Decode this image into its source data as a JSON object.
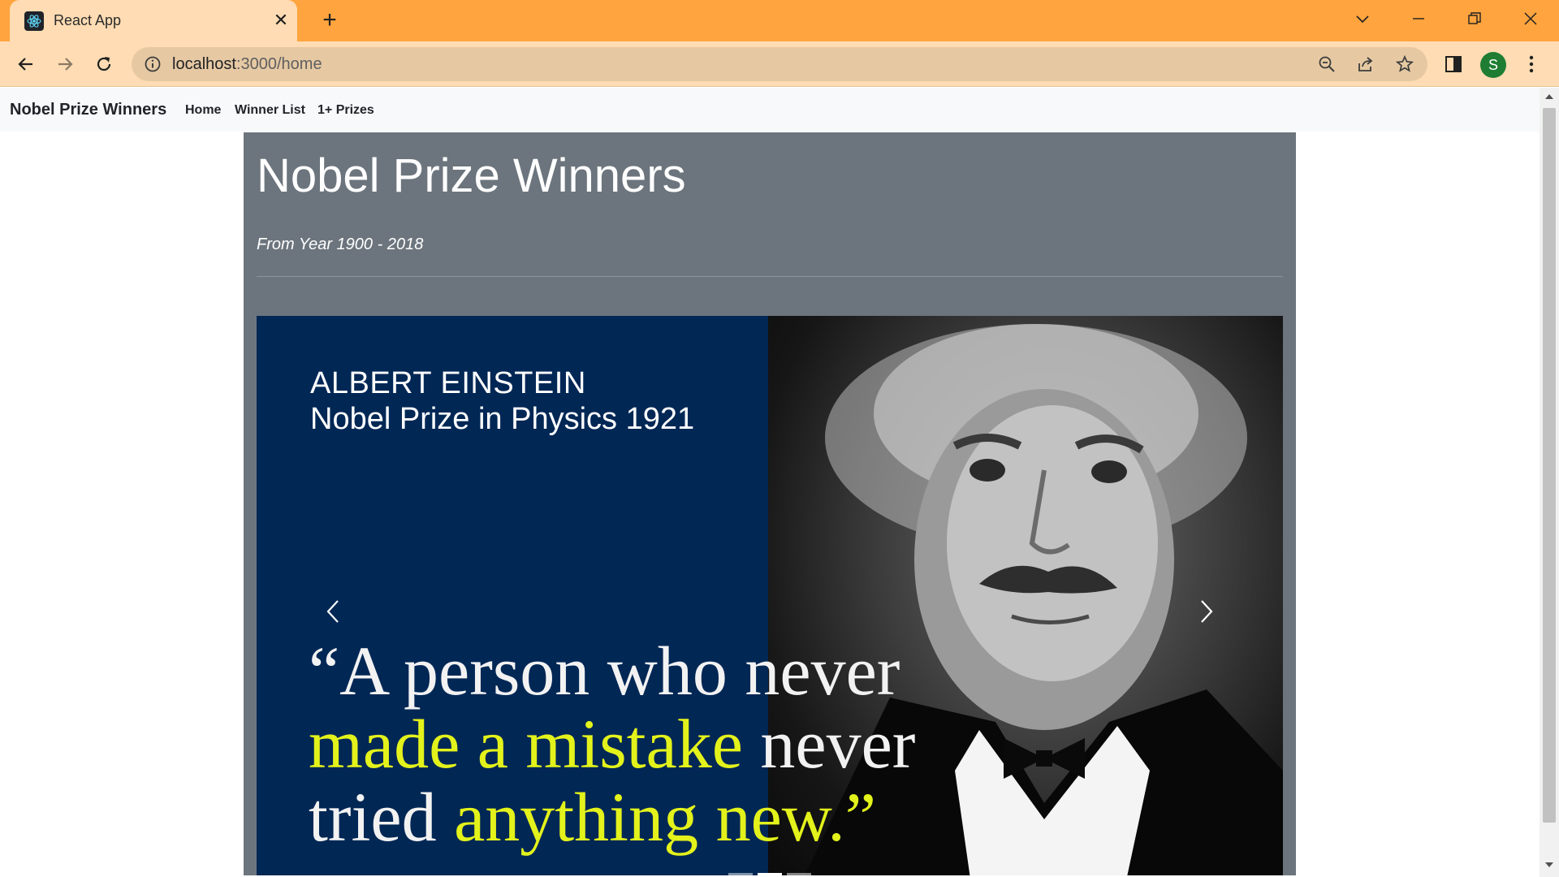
{
  "browser": {
    "tab_title": "React App",
    "tab_close": "✕",
    "new_tab": "+",
    "avatar_letter": "S",
    "url_host": "localhost",
    "url_rest": ":3000/home",
    "icons": [
      "react-favicon",
      "chevron-down-icon",
      "minimize-icon",
      "restore-icon",
      "close-icon",
      "back-arrow-icon",
      "forward-arrow-icon",
      "reload-icon",
      "info-icon",
      "zoom-out-icon",
      "share-icon",
      "star-icon",
      "side-panel-icon",
      "kebab-menu-icon"
    ],
    "theme_colors": {
      "tabbar": "#ffa43e",
      "toolbar": "#ffdcb3",
      "omnibox": "#e6c9a3"
    }
  },
  "navbar": {
    "brand": "Nobel Prize Winners",
    "links": [
      "Home",
      "Winner List",
      "1+ Prizes"
    ]
  },
  "jumbotron": {
    "title": "Nobel Prize Winners",
    "subtitle": "From Year 1900 - 2018",
    "background": "#6c757d"
  },
  "carousel": {
    "slide": {
      "name": "ALBERT EINSTEIN",
      "prize": "Nobel Prize in Physics 1921",
      "quote_1": "“A person who never",
      "quote_2a": "made a mistake",
      "quote_2b": " never",
      "quote_3a": "tried ",
      "quote_3b": "anything new.”",
      "highlight_color": "#e3f21b",
      "panel_color": "#012755"
    },
    "indicator_count": 3,
    "active_indicator": 2
  }
}
